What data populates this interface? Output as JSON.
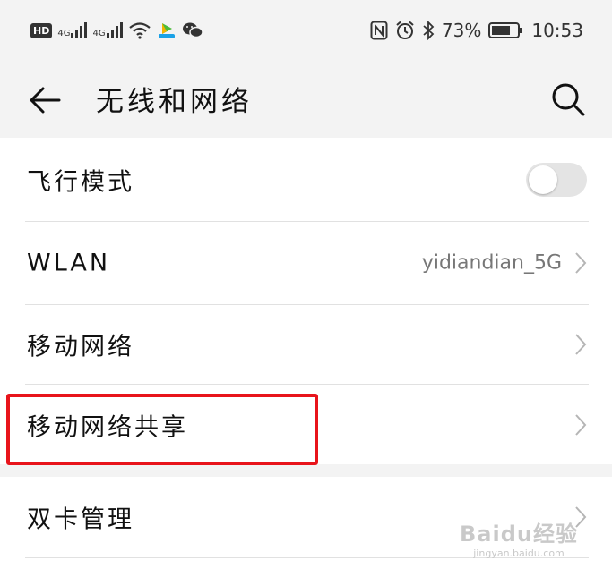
{
  "status_bar": {
    "hd_badge": "HD",
    "sim1_type": "4G",
    "sim2_type": "4G",
    "battery_percent": "73%",
    "time": "10:53",
    "icons": [
      "nfc-icon",
      "alarm-icon",
      "bluetooth-icon",
      "battery-icon",
      "wifi-icon",
      "app-icon",
      "wechat-icon"
    ]
  },
  "header": {
    "title": "无线和网络",
    "back_icon": "arrow-left-icon",
    "search_icon": "search-icon"
  },
  "settings": [
    {
      "label": "飞行模式",
      "control": "toggle",
      "state": "off"
    },
    {
      "label": "WLAN",
      "value": "yidiandian_5G",
      "control": "chevron"
    },
    {
      "label": "移动网络",
      "control": "chevron"
    },
    {
      "label": "移动网络共享",
      "control": "chevron",
      "highlighted": true
    },
    {
      "label": "双卡管理",
      "control": "chevron"
    }
  ],
  "annotation": {
    "highlight_color": "#e8141b"
  },
  "watermark": {
    "logo_text": "Baidu经验",
    "url": "jingyan.baidu.com"
  }
}
